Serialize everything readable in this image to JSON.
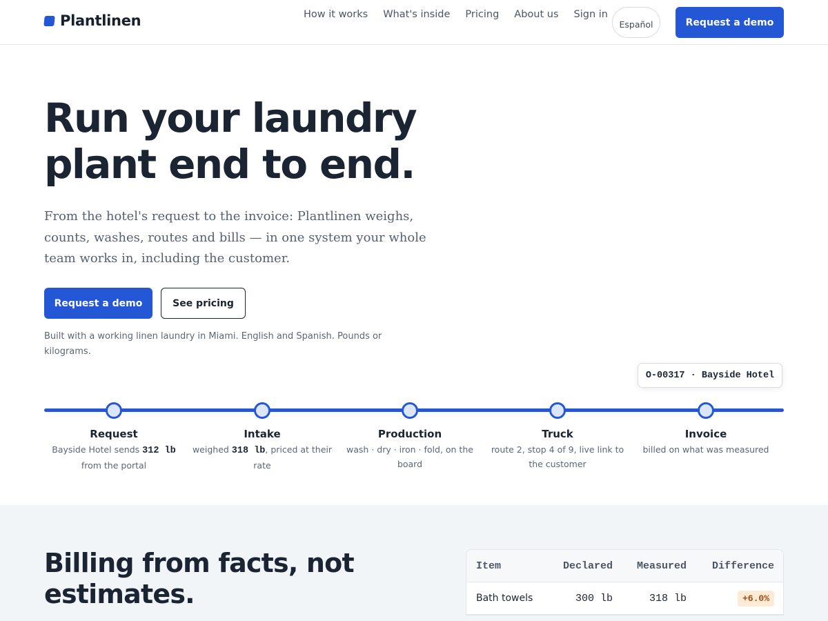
{
  "header": {
    "brand": "Plantlinen",
    "nav": [
      "How it works",
      "What's inside",
      "Pricing",
      "About us",
      "Sign in"
    ],
    "language": "Español",
    "cta": "Request a demo",
    "accent": "#2457d6"
  },
  "hero": {
    "title_line1": "Run your laundry",
    "title_line2": "plant end to end.",
    "subtitle": "From the hotel's request to the invoice: Plantlinen weighs, counts, washes, routes and bills — in one system your whole team works in, including the customer.",
    "primary_button": "Request a demo",
    "secondary_button": "See pricing",
    "note": "Built with a working linen laundry in Miami. English and Spanish. Pounds or kilograms."
  },
  "timeline": {
    "order_tag": "O-00317 · Bayside Hotel",
    "stages": [
      {
        "name": "Request",
        "pre": "Bayside Hotel sends ",
        "value": "312 lb",
        "post": " from the portal"
      },
      {
        "name": "Intake",
        "pre": "weighed ",
        "value": "318 lb",
        "post": ", priced at their rate"
      },
      {
        "name": "Production",
        "pre": "wash · dry · iron · fold, on the board",
        "value": "",
        "post": ""
      },
      {
        "name": "Truck",
        "pre": "route 2, stop 4 of 9, live link to the customer",
        "value": "",
        "post": ""
      },
      {
        "name": "Invoice",
        "pre": "billed on what was measured",
        "value": "",
        "post": ""
      }
    ]
  },
  "billing": {
    "title": "Billing from facts, not estimates.",
    "columns": [
      "Item",
      "Declared",
      "Measured",
      "Difference"
    ],
    "rows": [
      {
        "item": "Bath towels",
        "declared": "300 lb",
        "measured": "318 lb",
        "difference": "+6.0%"
      }
    ]
  }
}
